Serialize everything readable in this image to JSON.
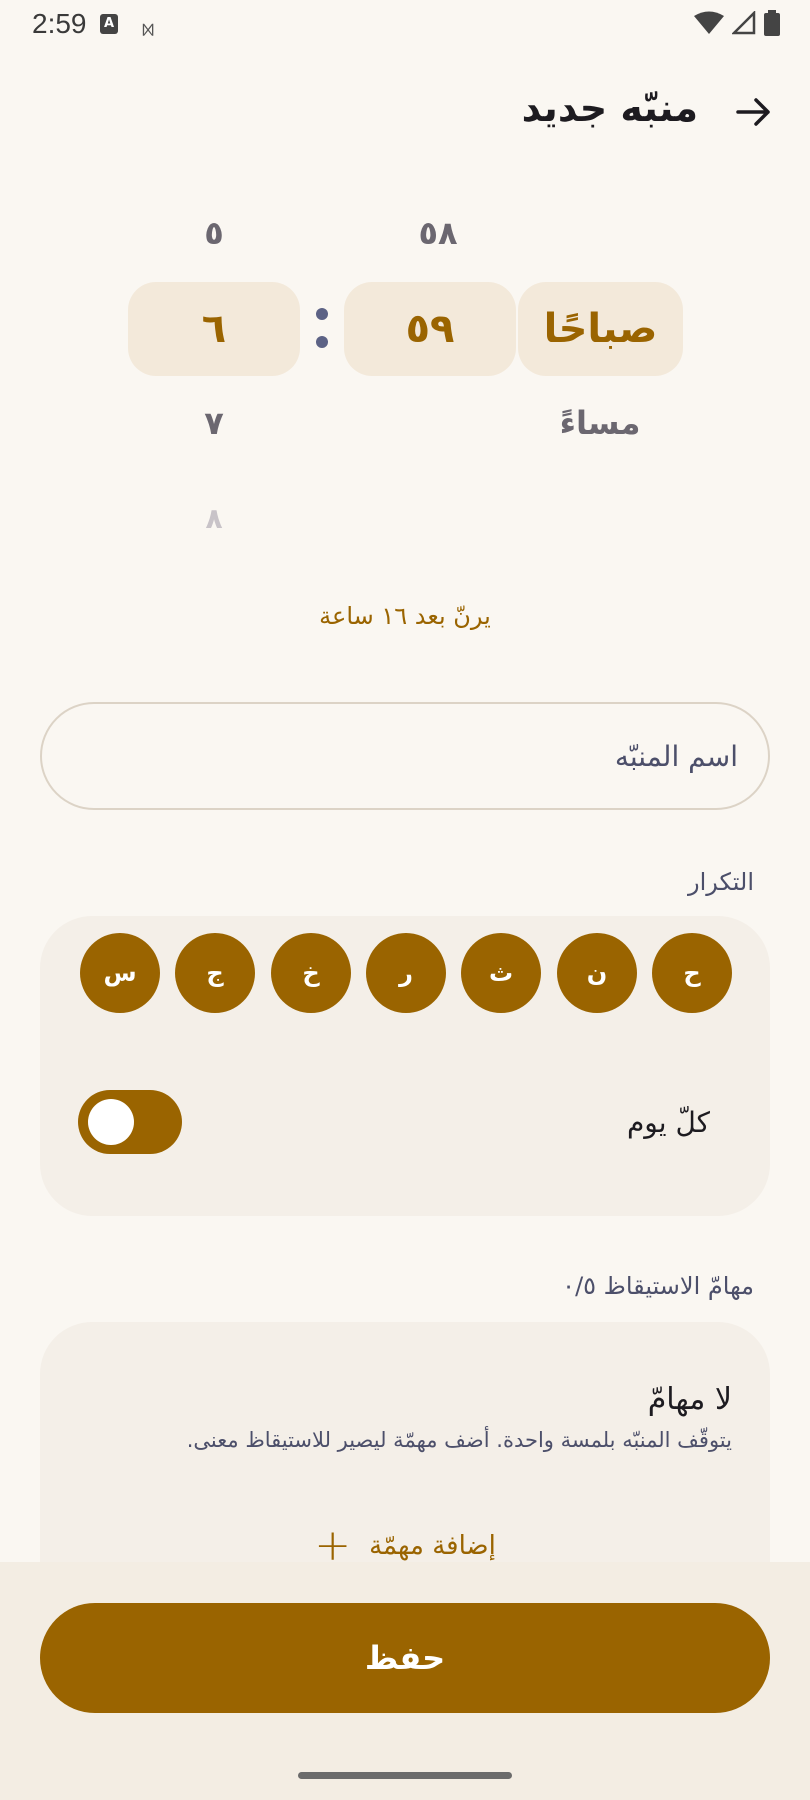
{
  "status_bar": {
    "time": "2:59",
    "a_badge": "A",
    "cat_glyph": "ᢂ"
  },
  "header": {
    "title": "منبّه جديد",
    "back_icon": "arrow-right-icon"
  },
  "time_picker": {
    "period_selected": "صباحًا",
    "period_next": "مساءً",
    "minute_prev": "٥٨",
    "minute_selected": "٥٩",
    "hour_prev": "٥",
    "hour_selected": "٦",
    "hour_next": "٧",
    "hour_next2": "٨"
  },
  "rings_in": "يرنّ بعد ١٦ ساعة",
  "name_field": {
    "placeholder": "اسم المنبّه",
    "value": ""
  },
  "repeat": {
    "label": "التكرار",
    "days": [
      "ح",
      "ن",
      "ث",
      "ر",
      "خ",
      "ج",
      "س"
    ],
    "everyday_label": "كلّ يوم",
    "everyday_on": true
  },
  "wake_tasks": {
    "label": "مهامّ الاستيقاظ ٠/٥",
    "empty_title": "لا مهامّ",
    "empty_sub": "يتوقّف المنبّه بلمسة واحدة. أضف مهمّة ليصير للاستيقاظ معنى.",
    "add_label": "إضافة مهمّة"
  },
  "save_label": "حفظ",
  "colors": {
    "accent": "#9a6400",
    "background": "#faf7f2",
    "card": "#f4efe8"
  }
}
